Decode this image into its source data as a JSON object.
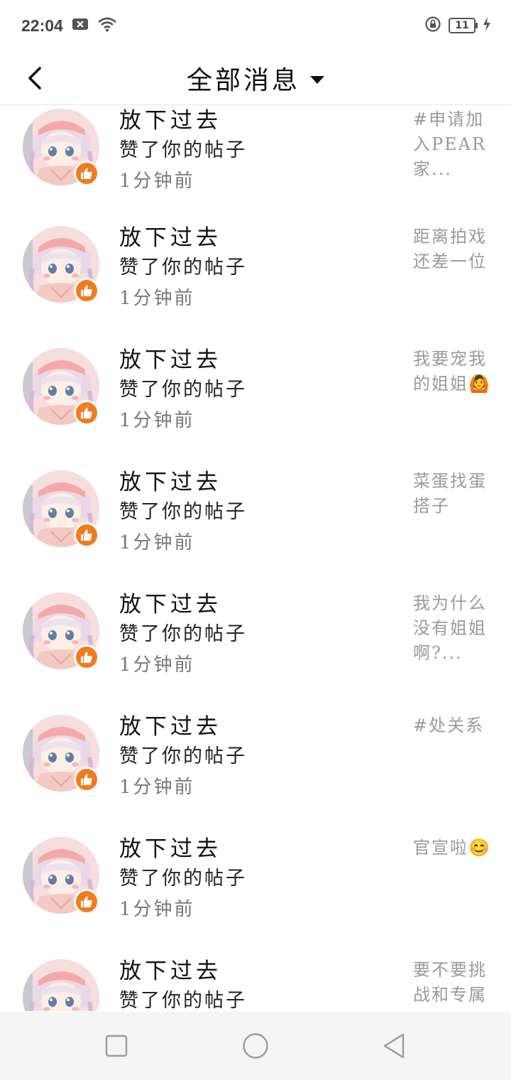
{
  "status_bar": {
    "time": "22:04",
    "battery": "11"
  },
  "header": {
    "title": "全部消息"
  },
  "messages": [
    {
      "name": "放下过去",
      "action": "赞了你的帖子",
      "time": "1分钟前",
      "snippet": "#申请加入PEAR家..."
    },
    {
      "name": "放下过去",
      "action": "赞了你的帖子",
      "time": "1分钟前",
      "snippet": "距离拍戏还差一位"
    },
    {
      "name": "放下过去",
      "action": "赞了你的帖子",
      "time": "1分钟前",
      "snippet": "我要宠我的姐姐🙆"
    },
    {
      "name": "放下过去",
      "action": "赞了你的帖子",
      "time": "1分钟前",
      "snippet": "菜蛋找蛋搭子"
    },
    {
      "name": "放下过去",
      "action": "赞了你的帖子",
      "time": "1分钟前",
      "snippet": "我为什么没有姐姐啊?..."
    },
    {
      "name": "放下过去",
      "action": "赞了你的帖子",
      "time": "1分钟前",
      "snippet": "#处关系"
    },
    {
      "name": "放下过去",
      "action": "赞了你的帖子",
      "time": "1分钟前",
      "snippet": "官宣啦😊"
    },
    {
      "name": "放下过去",
      "action": "赞了你的帖子",
      "time": "1分钟前",
      "snippet": "要不要挑战和专属"
    }
  ],
  "icons": {
    "back": "back-arrow-icon",
    "badge": "thumbs-up-icon",
    "nav_recent": "square-icon",
    "nav_home": "circle-icon",
    "nav_back": "triangle-back-icon"
  },
  "colors": {
    "badge": "#f37a1f",
    "snippet": "#9a9a9a",
    "navbar": "#f5f5f5"
  }
}
